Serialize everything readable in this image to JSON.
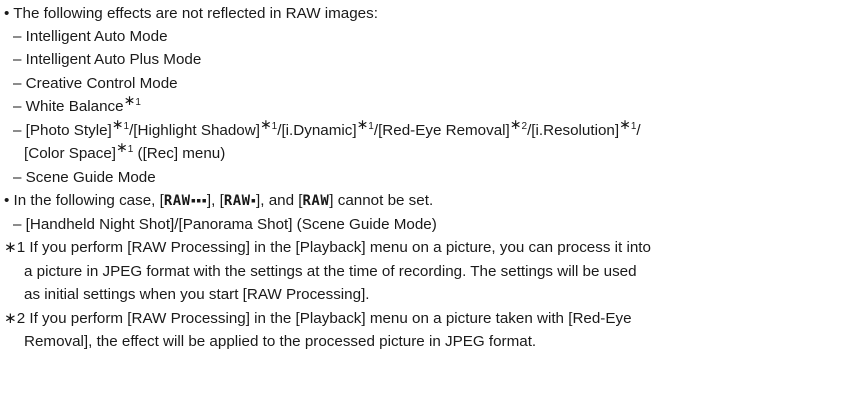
{
  "bullets": {
    "b1": "• The following effects are not reflected in RAW images:",
    "b2_start": "• In the following case, ",
    "b2_sep1": ", ",
    "b2_sep2": ", and ",
    "b2_end": " cannot be set."
  },
  "raw_labels": {
    "raw_fine": "RAW",
    "raw_fine_mark": "▪▪▪",
    "raw_std": "RAW",
    "raw_std_mark": "▪",
    "raw_only": "RAW"
  },
  "items": {
    "i1": "– Intelligent Auto Mode",
    "i2": "– Intelligent Auto Plus Mode",
    "i3": "– Creative Control Mode",
    "i4": "– White Balance",
    "i5_a": "– [Photo Style]",
    "i5_b": "/[Highlight Shadow]",
    "i5_c": "/[i.Dynamic]",
    "i5_d": "/[Red-Eye Removal]",
    "i5_e": "/[i.Resolution]",
    "i5_f": "/",
    "i5_cont": "[Color Space]",
    "i5_cont_tail": " ([Rec] menu)",
    "i6": "– Scene Guide Mode",
    "i7": "– [Handheld Night Shot]/[Panorama Shot] (Scene Guide Mode)"
  },
  "marks": {
    "ast": "∗",
    "one": "1",
    "two": "2"
  },
  "notes": {
    "n1_l1": "∗1 If you perform [RAW Processing] in the [Playback] menu on a picture, you can process it into",
    "n1_l2": "a picture in JPEG format with the settings at the time of recording. The settings will be used",
    "n1_l3": "as initial settings when you start [RAW Processing].",
    "n2_l1": "∗2 If you perform [RAW Processing] in the [Playback] menu on a picture taken with [Red-Eye",
    "n2_l2": "Removal], the effect will be applied to the processed picture in JPEG format."
  }
}
